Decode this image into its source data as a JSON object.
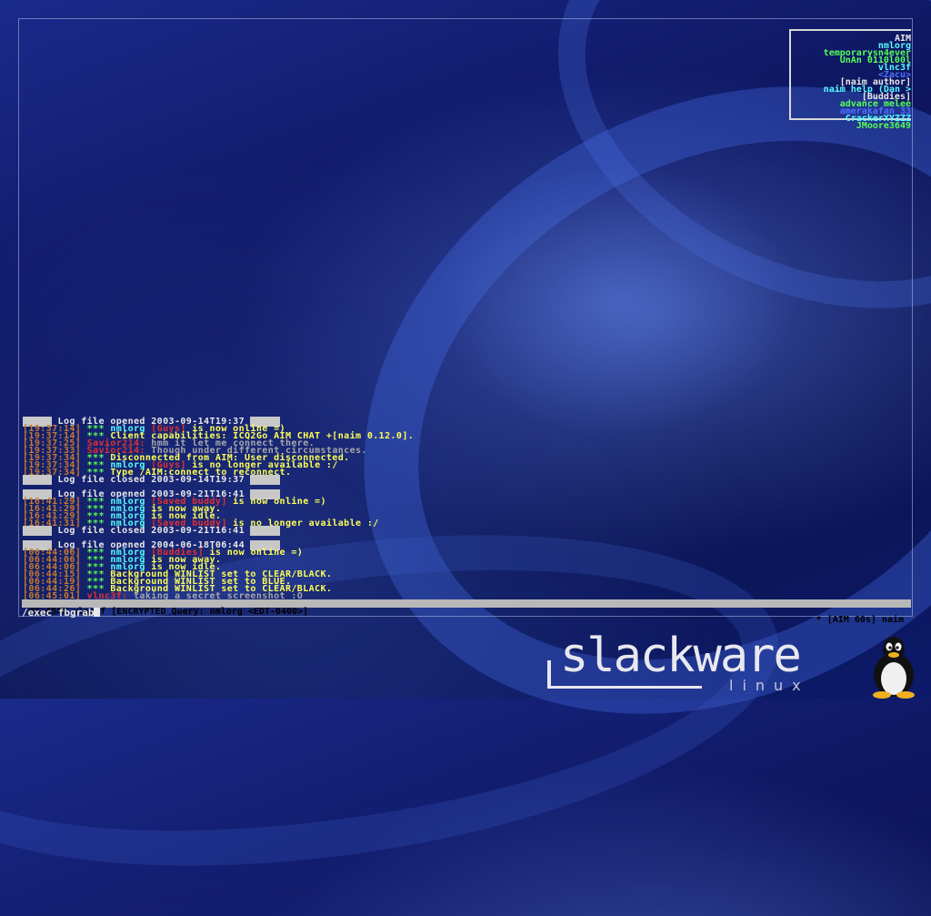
{
  "buddy_list": [
    {
      "text": "AIM",
      "color": "#e8e8e8"
    },
    {
      "text": "nmlorg",
      "color": "#55ffff"
    },
    {
      "text": "temporarysn4ever",
      "color": "#55ff55"
    },
    {
      "text": "UnAn 0110l00l",
      "color": "#55ff55"
    },
    {
      "text": "vlnc3f",
      "color": "#55ffff"
    },
    {
      "text": "<Zacu>",
      "color": "#5070ff"
    },
    {
      "text": "[naim author]",
      "color": "#e8e8e8"
    },
    {
      "text": "naim help (Dan >",
      "color": "#55ffff"
    },
    {
      "text": "[Buddies]",
      "color": "#e8e8e8"
    },
    {
      "text": "advance melee",
      "color": "#55ff55"
    },
    {
      "text": "amerakafan 33",
      "color": "#5070ff"
    },
    {
      "text": "CrackerXYZZZ",
      "color": "#55ffff"
    },
    {
      "text": "JMoore3649",
      "color": "#55ff55"
    }
  ],
  "log_lines": [
    [
      {
        "t": "-----",
        "c": "sep"
      },
      {
        "t": " Log file opened 2003-09-14T19:37 ",
        "c": "white"
      },
      {
        "t": "-----",
        "c": "sep"
      }
    ],
    [
      {
        "t": "[19:37:14]",
        "c": "orange"
      },
      {
        "t": " *** ",
        "c": "green"
      },
      {
        "t": "nmlorg ",
        "c": "cyan"
      },
      {
        "t": "[Guys]",
        "c": "red"
      },
      {
        "t": " is now online =)",
        "c": "yellow"
      }
    ],
    [
      {
        "t": "[19:37:14]",
        "c": "orange"
      },
      {
        "t": " *** ",
        "c": "green"
      },
      {
        "t": "Client capabilities: ICQ2Go AIM CHAT +[naim 0.12.0].",
        "c": "yellow"
      }
    ],
    [
      {
        "t": "[19:37:25]",
        "c": "orange"
      },
      {
        "t": " Savior214:",
        "c": "red"
      },
      {
        "t": " hmm it let me connect there.",
        "c": "gray"
      }
    ],
    [
      {
        "t": "[19:37:33]",
        "c": "orange"
      },
      {
        "t": " Savior214:",
        "c": "red"
      },
      {
        "t": " Though under different circumstances.",
        "c": "gray"
      }
    ],
    [
      {
        "t": "[19:37:34]",
        "c": "orange"
      },
      {
        "t": " *** ",
        "c": "green"
      },
      {
        "t": "Disconnected from AIM: User disconnected.",
        "c": "yellow"
      }
    ],
    [
      {
        "t": "[19:37:34]",
        "c": "orange"
      },
      {
        "t": " *** ",
        "c": "green"
      },
      {
        "t": "nmlorg ",
        "c": "cyan"
      },
      {
        "t": "[Guys]",
        "c": "red"
      },
      {
        "t": " is no longer available :/",
        "c": "yellow"
      }
    ],
    [
      {
        "t": "[19:37:34]",
        "c": "orange"
      },
      {
        "t": " *** ",
        "c": "green"
      },
      {
        "t": "Type /AIM:connect to reconnect.",
        "c": "yellow"
      }
    ],
    [
      {
        "t": "-----",
        "c": "sep"
      },
      {
        "t": " Log file closed 2003-09-14T19:37 ",
        "c": "white"
      },
      {
        "t": "-----",
        "c": "sep"
      }
    ],
    [],
    [
      {
        "t": "-----",
        "c": "sep"
      },
      {
        "t": " Log file opened 2003-09-21T16:41 ",
        "c": "white"
      },
      {
        "t": "-----",
        "c": "sep"
      }
    ],
    [
      {
        "t": "[16:41:29]",
        "c": "orange"
      },
      {
        "t": " *** ",
        "c": "green"
      },
      {
        "t": "nmlorg ",
        "c": "cyan"
      },
      {
        "t": "[Saved buddy]",
        "c": "red"
      },
      {
        "t": " is now online =)",
        "c": "yellow"
      }
    ],
    [
      {
        "t": "[16:41:29]",
        "c": "orange"
      },
      {
        "t": " *** ",
        "c": "green"
      },
      {
        "t": "nmlorg ",
        "c": "cyan"
      },
      {
        "t": "is now away.",
        "c": "yellow"
      }
    ],
    [
      {
        "t": "[16:41:29]",
        "c": "orange"
      },
      {
        "t": " *** ",
        "c": "green"
      },
      {
        "t": "nmlorg ",
        "c": "cyan"
      },
      {
        "t": "is now idle.",
        "c": "yellow"
      }
    ],
    [
      {
        "t": "[16:41:31]",
        "c": "orange"
      },
      {
        "t": " *** ",
        "c": "green"
      },
      {
        "t": "nmlorg ",
        "c": "cyan"
      },
      {
        "t": "[Saved buddy]",
        "c": "red"
      },
      {
        "t": " is no longer available :/",
        "c": "yellow"
      }
    ],
    [
      {
        "t": "-----",
        "c": "sep"
      },
      {
        "t": " Log file closed 2003-09-21T16:41 ",
        "c": "white"
      },
      {
        "t": "-----",
        "c": "sep"
      }
    ],
    [],
    [
      {
        "t": "-----",
        "c": "sep"
      },
      {
        "t": " Log file opened 2004-06-18T06:44 ",
        "c": "white"
      },
      {
        "t": "-----",
        "c": "sep"
      }
    ],
    [
      {
        "t": "[06:44:06]",
        "c": "orange"
      },
      {
        "t": " *** ",
        "c": "green"
      },
      {
        "t": "nmlorg ",
        "c": "cyan"
      },
      {
        "t": "[Buddies]",
        "c": "red"
      },
      {
        "t": " is now online =)",
        "c": "yellow"
      }
    ],
    [
      {
        "t": "[06:44:06]",
        "c": "orange"
      },
      {
        "t": " *** ",
        "c": "green"
      },
      {
        "t": "nmlorg ",
        "c": "cyan"
      },
      {
        "t": "is now away.",
        "c": "yellow"
      }
    ],
    [
      {
        "t": "[06:44:06]",
        "c": "orange"
      },
      {
        "t": " *** ",
        "c": "green"
      },
      {
        "t": "nmlorg ",
        "c": "cyan"
      },
      {
        "t": "is now idle.",
        "c": "yellow"
      }
    ],
    [
      {
        "t": "[06:44:15]",
        "c": "orange"
      },
      {
        "t": " *** ",
        "c": "green"
      },
      {
        "t": "Background WINLIST set to CLEAR/BLACK.",
        "c": "yellow"
      }
    ],
    [
      {
        "t": "[06:44:19]",
        "c": "orange"
      },
      {
        "t": " *** ",
        "c": "green"
      },
      {
        "t": "Background WINLIST set to BLUE.",
        "c": "yellow"
      }
    ],
    [
      {
        "t": "[06:44:26]",
        "c": "orange"
      },
      {
        "t": " *** ",
        "c": "green"
      },
      {
        "t": "Background WINLIST set to CLEAR/BLACK.",
        "c": "yellow"
      }
    ],
    [
      {
        "t": "[06:45:01]",
        "c": "orange"
      },
      {
        "t": " vlnc3f:",
        "c": "red"
      },
      {
        "t": " taking a secret screenshot :O",
        "c": "gray"
      }
    ]
  ],
  "status_bar": {
    "left": "06:45AM vlnc3f [ENCRYPTED Query: nmlorg <EDT-0400>]",
    "right": "* [AIM 60s] naim"
  },
  "command_line": "/exec fbgrab",
  "logo": {
    "text": "slackware",
    "subtext": "linux"
  }
}
